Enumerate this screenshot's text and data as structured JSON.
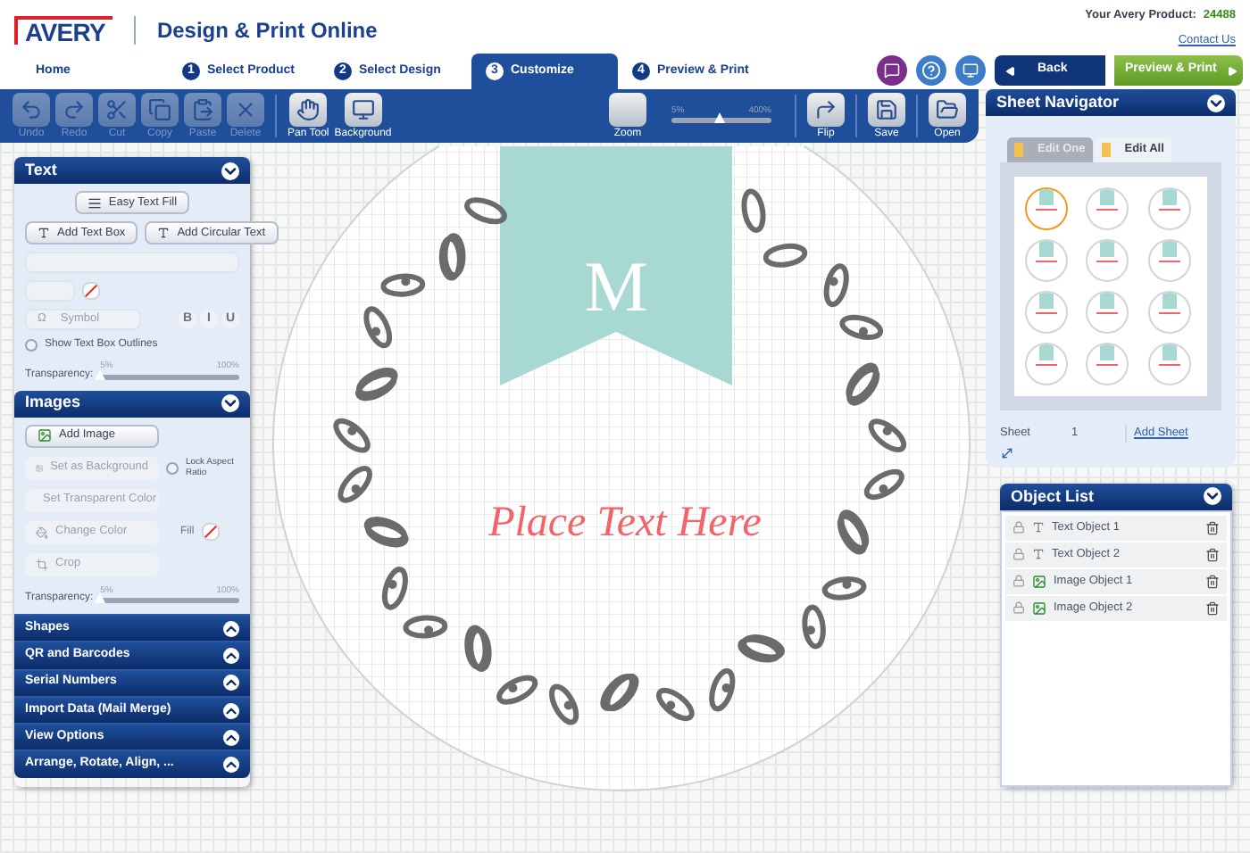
{
  "header": {
    "logo": "AVERY",
    "title": "Design & Print Online",
    "product_label": "Your Avery Product:",
    "product_number": "24488",
    "contact": "Contact Us"
  },
  "steps": [
    {
      "label": "Home",
      "selected": false
    },
    {
      "number": "1",
      "label": "Select Product",
      "selected": false
    },
    {
      "number": "2",
      "label": "Select Design",
      "selected": false
    },
    {
      "number": "3",
      "label": "Customize",
      "selected": true
    },
    {
      "number": "4",
      "label": "Preview & Print",
      "selected": false
    }
  ],
  "nav_buttons": [
    {
      "kind": "back",
      "label": "Back"
    },
    {
      "kind": "forward",
      "label": "Preview & Print"
    }
  ],
  "toolbar": {
    "tools": [
      {
        "kind": "undo",
        "label": "Undo",
        "disabled": true
      },
      {
        "kind": "redo",
        "label": "Redo",
        "disabled": true
      },
      {
        "kind": "cut",
        "label": "Cut",
        "disabled": true
      },
      {
        "kind": "copy",
        "label": "Copy",
        "disabled": true
      },
      {
        "kind": "paste",
        "label": "Paste",
        "disabled": true
      },
      {
        "kind": "delete",
        "label": "Delete",
        "disabled": true
      },
      {
        "kind": "pan",
        "label": "Pan Tool",
        "disabled": false
      },
      {
        "kind": "background",
        "label": "Background",
        "disabled": false
      }
    ],
    "zoom": {
      "label": "Zoom",
      "min": "5%",
      "max": "400%",
      "level": 0.48
    },
    "tools_right": [
      {
        "kind": "flip",
        "label": "Flip"
      },
      {
        "kind": "save",
        "label": "Save"
      },
      {
        "kind": "open",
        "label": "Open"
      }
    ]
  },
  "text_panel": {
    "title": "Text",
    "easy_fill": "Easy Text Fill",
    "add_text_box": "Add Text Box",
    "add_circular": "Add Circular Text",
    "symbol_glyph": "Ω",
    "symbol": "Symbol",
    "style_buttons": [
      "B",
      "I",
      "U"
    ],
    "outlines": {
      "label": "Show Text Box Outlines",
      "checked": false
    },
    "transparency": {
      "label": "Transparency:",
      "min": "5%",
      "max": "100%",
      "level": 0
    }
  },
  "images_panel": {
    "title": "Images",
    "add_image": "Add Image",
    "set_background": "Set as Background",
    "lock_aspect": {
      "label": "Lock Aspect Ratio",
      "checked": false
    },
    "transparent_color": "Set Transparent Color",
    "change_color": "Change Color",
    "fill": "Fill",
    "crop": "Crop",
    "transparency": {
      "label": "Transparency:",
      "min": "5%",
      "max": "100%",
      "level": 0
    }
  },
  "collapsed_sections": [
    "Shapes",
    "QR and Barcodes",
    "Serial Numbers",
    "Import Data (Mail Merge)",
    "View Options",
    "Arrange, Rotate, Align, ..."
  ],
  "canvas": {
    "monogram": "M",
    "text": "Place Text Here"
  },
  "sheet_navigator": {
    "title": "Sheet Navigator",
    "tabs": [
      {
        "label": "Edit One",
        "selected": false
      },
      {
        "label": "Edit All",
        "selected": true
      }
    ],
    "labels": [
      {
        "selected": true
      },
      {
        "selected": false
      },
      {
        "selected": false
      },
      {
        "selected": false
      },
      {
        "selected": false
      },
      {
        "selected": false
      },
      {
        "selected": false
      },
      {
        "selected": false
      },
      {
        "selected": false
      },
      {
        "selected": false
      },
      {
        "selected": false
      },
      {
        "selected": false
      }
    ],
    "sheet_label": "Sheet",
    "sheet_number": "1",
    "add_sheet": "Add Sheet"
  },
  "object_list": {
    "title": "Object List",
    "items": [
      {
        "kind": "text",
        "label": "Text Object 1"
      },
      {
        "kind": "text",
        "label": "Text Object 2"
      },
      {
        "kind": "image",
        "label": "Image Object 1"
      },
      {
        "kind": "image",
        "label": "Image Object 2"
      }
    ]
  }
}
